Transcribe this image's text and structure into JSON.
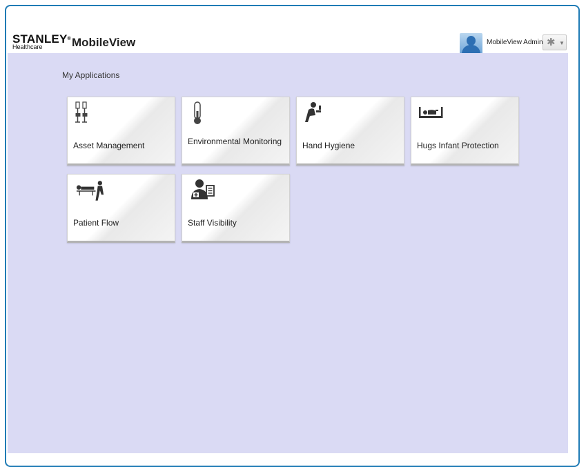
{
  "header": {
    "brand": "STANLEY",
    "brand_sub": "Healthcare",
    "app_name": "MobileView",
    "user_name": "MobileView Admin"
  },
  "main": {
    "section_title": "My Applications",
    "tiles": [
      {
        "label": "Asset Management",
        "icon": "iv-pole-icon"
      },
      {
        "label": "Environmental Monitoring",
        "icon": "thermometer-icon"
      },
      {
        "label": "Hand Hygiene",
        "icon": "hand-washing-icon"
      },
      {
        "label": "Hugs Infant Protection",
        "icon": "infant-crib-icon"
      },
      {
        "label": "Patient Flow",
        "icon": "patient-stretcher-icon"
      },
      {
        "label": "Staff Visibility",
        "icon": "staff-badge-icon"
      }
    ]
  },
  "colors": {
    "frame_border": "#1f7bb5",
    "content_background": "#dadaf4",
    "tile_background": "#ffffff"
  }
}
